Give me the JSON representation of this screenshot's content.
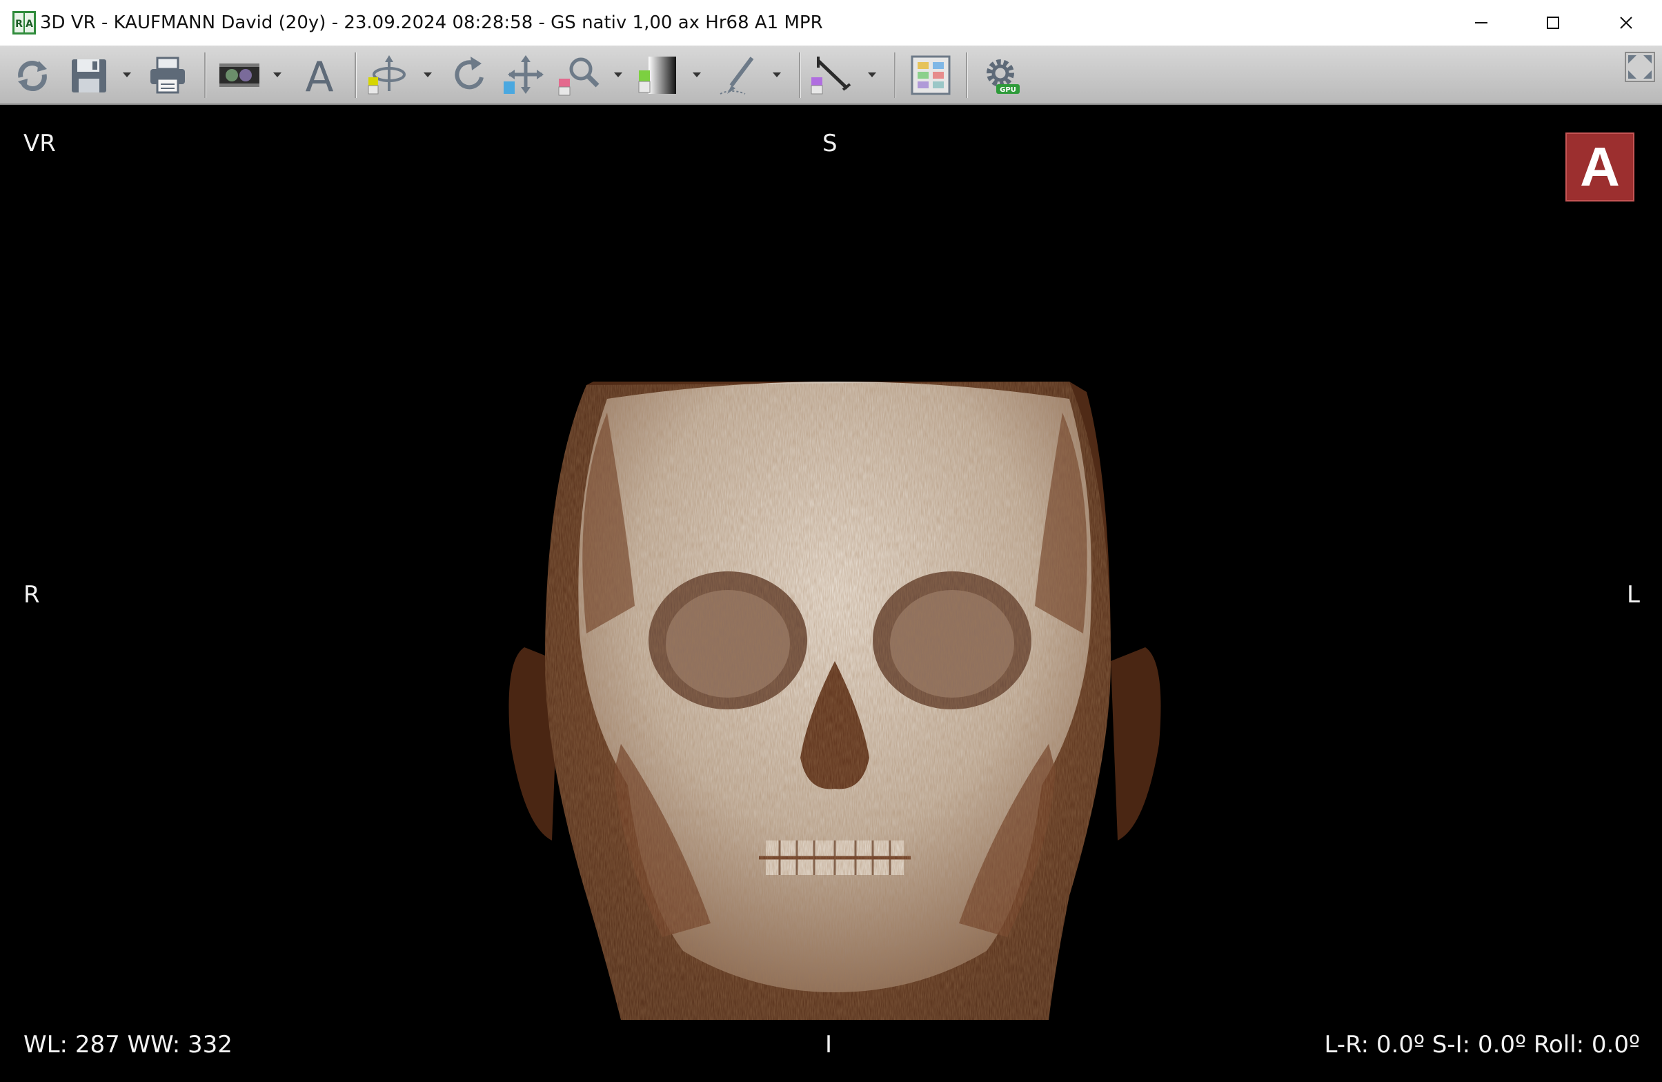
{
  "window": {
    "title": "3D VR - KAUFMANN David (20y) - 23.09.2024 08:28:58 - GS nativ 1,00 ax Hr68 A1 MPR",
    "icon": "radiant-app-icon",
    "controls": [
      "minimize-icon",
      "maximize-icon",
      "close-icon"
    ]
  },
  "toolbar": {
    "tools": [
      "reset-view-icon",
      "save-icon",
      "print-icon",
      "stereo-view-icon",
      "annotation-text-icon",
      "rotate-3d-icon",
      "rotate-icon",
      "pan-icon",
      "zoom-icon",
      "window-level-icon",
      "scalpel-cut-icon",
      "measure-icon",
      "layout-grid-icon",
      "gpu-settings-icon",
      "fullscreen-icon"
    ]
  },
  "viewport": {
    "mode_label": "VR",
    "orientation": {
      "top": "S",
      "bottom": "I",
      "left": "R",
      "right": "L"
    },
    "cube_letter": "A",
    "window_level": "WL: 287 WW: 332",
    "rotation": "L-R: 0.0º S-I: 0.0º Roll: 0.0º"
  },
  "colors": {
    "accent_cube": "#9c2f2f",
    "render_tint": "#6b3a22"
  }
}
